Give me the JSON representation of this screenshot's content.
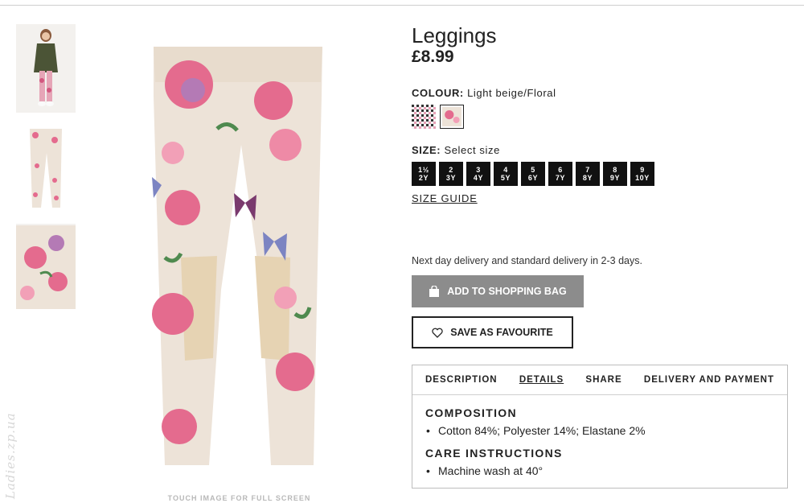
{
  "product": {
    "title": "Leggings",
    "price": "£8.99"
  },
  "colour": {
    "label": "COLOUR:",
    "value": "Light beige/Floral",
    "swatches": [
      "houndstooth",
      "beige-floral"
    ]
  },
  "size": {
    "label": "SIZE:",
    "value": "Select size",
    "options": [
      {
        "top": "1½",
        "bottom": "2Y"
      },
      {
        "top": "2",
        "bottom": "3Y"
      },
      {
        "top": "3",
        "bottom": "4Y"
      },
      {
        "top": "4",
        "bottom": "5Y"
      },
      {
        "top": "5",
        "bottom": "6Y"
      },
      {
        "top": "6",
        "bottom": "7Y"
      },
      {
        "top": "7",
        "bottom": "8Y"
      },
      {
        "top": "8",
        "bottom": "9Y"
      },
      {
        "top": "9",
        "bottom": "10Y"
      }
    ],
    "guide_label": "SIZE GUIDE"
  },
  "delivery_text": "Next day delivery and standard delivery in 2-3 days.",
  "buttons": {
    "add_to_bag": "ADD TO SHOPPING BAG",
    "add_to_bag_icon": "shopping-bag-icon",
    "favourite": "SAVE AS FAVOURITE",
    "favourite_icon": "heart-icon"
  },
  "tabs": [
    {
      "label": "DESCRIPTION",
      "active": false
    },
    {
      "label": "DETAILS",
      "active": true
    },
    {
      "label": "SHARE",
      "active": false
    },
    {
      "label": "DELIVERY AND PAYMENT",
      "active": false
    }
  ],
  "details": {
    "composition_heading": "COMPOSITION",
    "composition": "Cotton 84%; Polyester 14%; Elastane 2%",
    "care_heading": "CARE INSTRUCTIONS",
    "care": "Machine wash at 40°"
  },
  "image_hint": "TOUCH IMAGE FOR FULL SCREEN",
  "watermark": "Ladies.zp.ua",
  "colors": {
    "bag_button_bg": "#8c8c8c",
    "size_button_bg": "#111111",
    "fabric_beige": "#ede3d8",
    "flower_pink": "#e46b8e"
  }
}
